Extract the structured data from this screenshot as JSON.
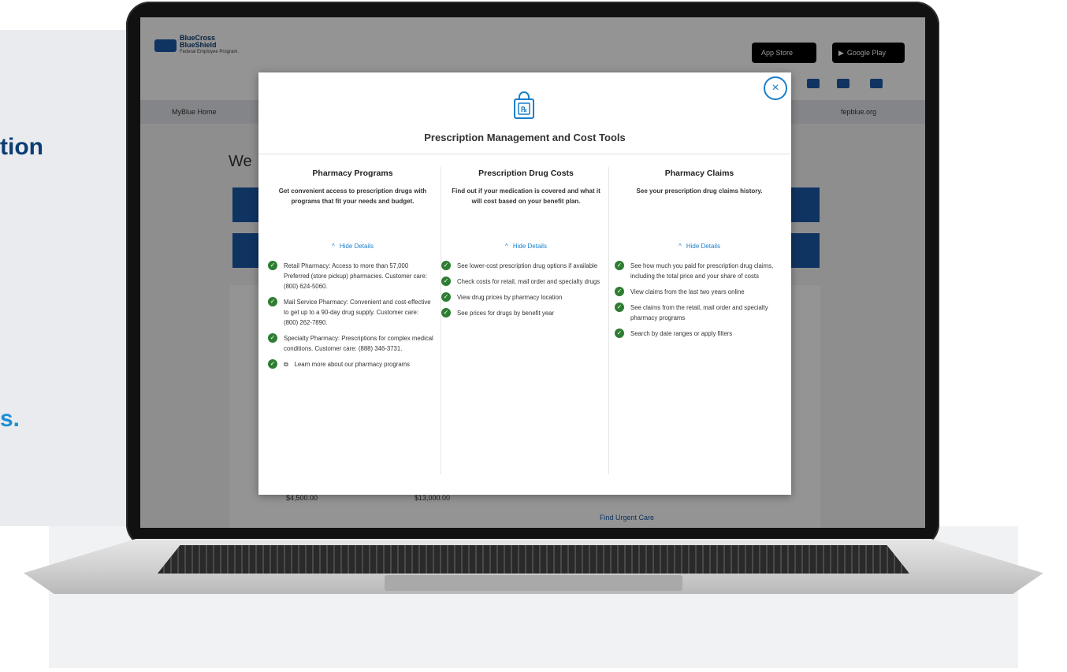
{
  "background": {
    "fragment_top": "tion",
    "fragment_bottom": "s.",
    "colors": {
      "navy": "#0b3d73",
      "blue": "#1a8fd6"
    }
  },
  "site": {
    "logo": {
      "line1": "BlueCross",
      "line2": "BlueShield",
      "sub": "Federal Employee Program."
    },
    "app_store": "App Store",
    "google_play": "Google Play",
    "nav_home": "MyBlue Home",
    "nav_site": "fepblue.org",
    "welcome": "We",
    "amount_1": "$4,500.00",
    "amount_2": "$13,000.00",
    "urgent_care": "Find Urgent Care"
  },
  "modal": {
    "close_label": "×",
    "icon": "prescription-bag-icon",
    "title": "Prescription Management and Cost Tools",
    "columns": [
      {
        "heading": "Pharmacy Programs",
        "description": "Get convenient access to prescription drugs with programs that fit your needs and budget.",
        "toggle": "Hide Details",
        "items": [
          "Retail Pharmacy: Access to more than 57,000 Preferred (store pickup) pharmacies. Customer care: (800) 624-5060.",
          "Mail Service Pharmacy: Convenient and cost-effective to get up to a 90-day drug supply. Customer care: (800) 262-7890.",
          "Specialty Pharmacy: Prescriptions for complex medical conditions. Customer care: (888) 346-3731.",
          "Learn more about our pharmacy programs"
        ]
      },
      {
        "heading": "Prescription Drug Costs",
        "description": "Find out if your medication is covered and what it will cost based on your benefit plan.",
        "toggle": "Hide Details",
        "items": [
          "See lower-cost prescription drug options if available",
          "Check costs for retail, mail order and specialty drugs",
          "View drug prices by pharmacy location",
          "See prices for drugs by benefit year"
        ]
      },
      {
        "heading": "Pharmacy Claims",
        "description": "See your prescription drug claims history.",
        "toggle": "Hide Details",
        "items": [
          "See how much you paid for prescription drug claims, including the total price and your share of costs",
          "View claims from the last two years online",
          "See claims from the retail, mail order and specialty pharmacy programs",
          "Search by date ranges or apply filters"
        ]
      }
    ],
    "colors": {
      "accent": "#1a7fc9",
      "check": "#2e7d32"
    }
  }
}
